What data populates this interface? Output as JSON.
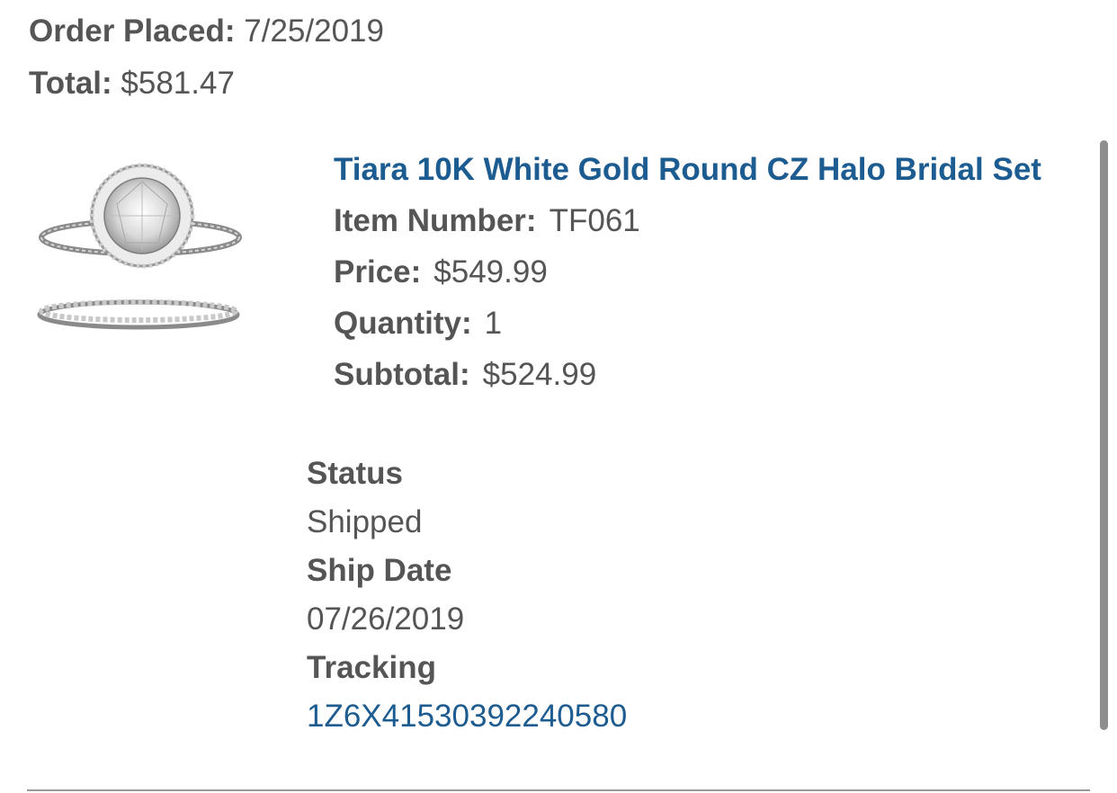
{
  "order": {
    "placed_label": "Order Placed:",
    "placed_value": "7/25/2019",
    "total_label": "Total:",
    "total_value": "$581.47"
  },
  "item": {
    "title": "Tiara 10K White Gold Round CZ Halo Bridal Set",
    "image_icon": "ring-product-image",
    "item_number_label": "Item Number:",
    "item_number_value": "TF061",
    "price_label": "Price:",
    "price_value": "$549.99",
    "quantity_label": "Quantity:",
    "quantity_value": "1",
    "subtotal_label": "Subtotal:",
    "subtotal_value": "$524.99"
  },
  "shipping": {
    "status_label": "Status",
    "status_value": "Shipped",
    "ship_date_label": "Ship Date",
    "ship_date_value": "07/26/2019",
    "tracking_label": "Tracking",
    "tracking_value": "1Z6X41530392240580"
  },
  "colors": {
    "link": "#1d5c91",
    "text": "#555555",
    "scrollbar": "#8e8e8e"
  }
}
